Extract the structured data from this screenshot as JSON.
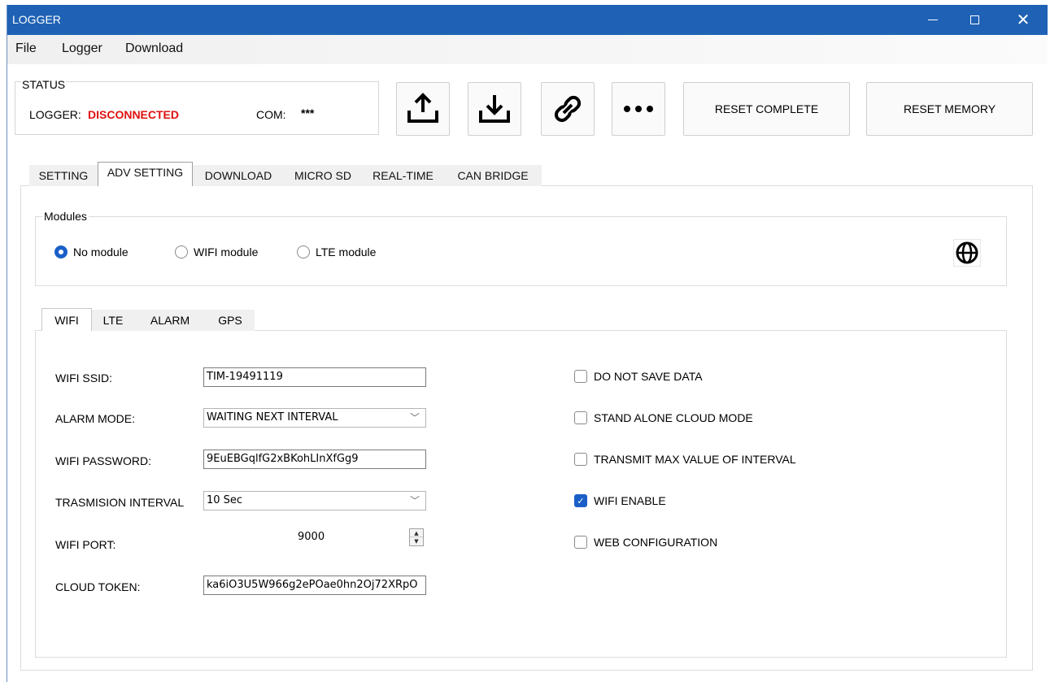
{
  "window": {
    "title": "LOGGER",
    "minimize_icon": "minimize-icon",
    "maximize_icon": "maximize-icon",
    "close_icon": "close-icon",
    "close_glyph": "✕"
  },
  "menu": {
    "items": [
      "File",
      "Logger",
      "Download"
    ]
  },
  "status": {
    "legend": "STATUS",
    "logger_label": "LOGGER:",
    "logger_value": "DISCONNECTED",
    "logger_color": "#e01010",
    "com_label": "COM:",
    "com_value": "***"
  },
  "toolbar": {
    "icons": [
      "upload-icon",
      "download-icon",
      "link-icon",
      "more-icon"
    ],
    "reset_complete": "RESET COMPLETE",
    "reset_memory": "RESET MEMORY"
  },
  "tabs": {
    "items": [
      "SETTING",
      "ADV SETTING",
      "DOWNLOAD",
      "MICRO SD",
      "REAL-TIME",
      "CAN BRIDGE"
    ],
    "active": "ADV SETTING"
  },
  "modules": {
    "legend": "Modules",
    "options": [
      "No module",
      "WIFI module",
      "LTE module"
    ],
    "selected": "No module",
    "globe_icon": "globe-icon"
  },
  "subtabs": {
    "items": [
      "WIFI",
      "LTE",
      "ALARM",
      "GPS"
    ],
    "active": "WIFI"
  },
  "wifi": {
    "ssid_label": "WIFI  SSID:",
    "ssid_value": "TIM-19491119",
    "alarm_mode_label": "ALARM MODE:",
    "alarm_mode_value": "WAITING NEXT INTERVAL",
    "password_label": "WIFI  PASSWORD:",
    "password_value": "9EuEBGqlfG2xBKohLInXfGg9",
    "interval_label": "TRASMISION INTERVAL",
    "interval_value": "10 Sec",
    "port_label": "WIFI  PORT:",
    "port_value": "9000",
    "token_label": "CLOUD TOKEN:",
    "token_value": "ka6iO3U5W966g2ePOae0hn2Oj72XRpO",
    "checkboxes": [
      {
        "label": "DO NOT SAVE DATA",
        "checked": false
      },
      {
        "label": "STAND ALONE CLOUD MODE",
        "checked": false
      },
      {
        "label": "TRANSMIT MAX VALUE OF INTERVAL",
        "checked": false
      },
      {
        "label": "WIFI ENABLE",
        "checked": true
      },
      {
        "label": "WEB CONFIGURATION",
        "checked": false
      }
    ]
  },
  "colors": {
    "titlebar": "#1f62b5",
    "accent": "#1a5fc7"
  }
}
